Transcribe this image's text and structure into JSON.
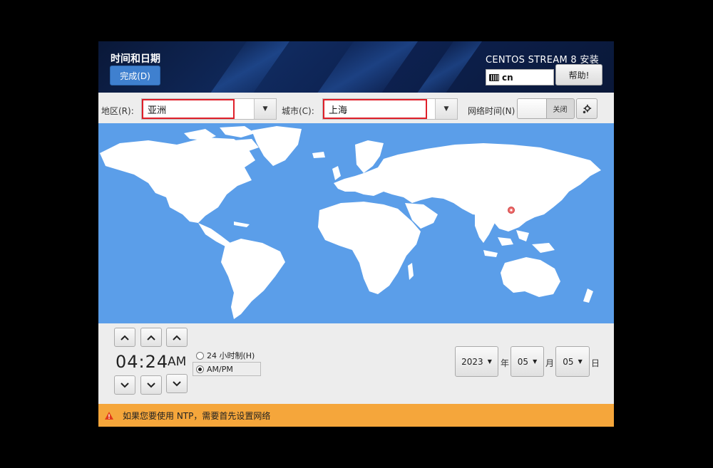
{
  "header": {
    "title": "时间和日期",
    "done_label": "完成(D)",
    "product_title": "CENTOS STREAM 8 安装",
    "keyboard_layout": "cn",
    "help_label": "帮助!"
  },
  "selectors": {
    "region_label": "地区(R):",
    "region_value": "亚洲",
    "city_label": "城市(C):",
    "city_value": "上海",
    "network_time_label": "网络时间(N)",
    "network_time_toggle": "关闭"
  },
  "map": {
    "selected_city_marker": "shanghai-marker"
  },
  "time": {
    "hours": "04",
    "separator": ":",
    "minutes": "24",
    "period": "AM",
    "format_24h_label": "24 小时制(H)",
    "format_ampm_label": "AM/PM",
    "selected_format": "AM/PM"
  },
  "date": {
    "year": "2023",
    "year_unit": "年",
    "month": "05",
    "month_unit": "月",
    "day": "05",
    "day_unit": "日"
  },
  "warning": {
    "icon": "warning-icon",
    "text": "如果您要使用 NTP，需要首先设置网络"
  },
  "colors": {
    "header_bg": "#0d2150",
    "done_button": "#3f80cf",
    "map_water": "#5b9ee9",
    "map_land": "#ffffff",
    "highlight_border": "#e0202a",
    "warning_bar": "#f5a63b"
  }
}
